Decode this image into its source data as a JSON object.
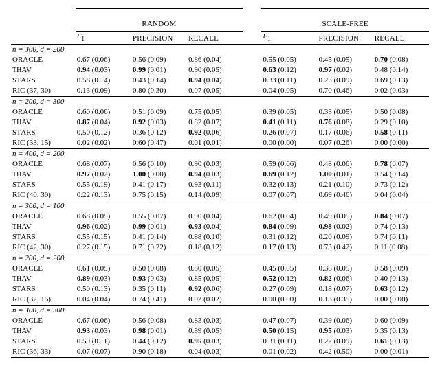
{
  "headers": {
    "super_left": "RANDOM",
    "super_right": "SCALE-FREE",
    "f1": "F",
    "f1_sub": "1",
    "precision": "PRECISION",
    "recall": "RECALL"
  },
  "row_labels": {
    "oracle": "ORACLE",
    "thav": "THAV",
    "stars": "STARS",
    "ric": "RIC"
  },
  "chart_data": {
    "type": "table",
    "columns": [
      "RANDOM F1",
      "RANDOM Precision",
      "RANDOM Recall",
      "SCALE-FREE F1",
      "SCALE-FREE Precision",
      "SCALE-FREE Recall"
    ],
    "blocks": [
      {
        "title": "n = 300, d = 200",
        "ric_suffix": " (37, 30)",
        "cells": [
          [
            "0.67 (0.06)",
            "0.56 (0.09)",
            "0.86 (0.04)",
            "0.55 (0.05)",
            "0.45 (0.05)",
            "0.70 (0.08)"
          ],
          [
            "0.94 (0.03)",
            "0.99 (0.01)",
            "0.90 (0.05)",
            "0.63 (0.12)",
            "0.97 (0.02)",
            "0.48 (0.14)"
          ],
          [
            "0.58 (0.14)",
            "0.43 (0.14)",
            "0.94 (0.04)",
            "0.33 (0.11)",
            "0.23 (0.09)",
            "0.69 (0.13)"
          ],
          [
            "0.13 (0.09)",
            "0.80 (0.30)",
            "0.07 (0.05)",
            "0.04 (0.05)",
            "0.70 (0.46)",
            "0.02 (0.03)"
          ]
        ],
        "bold": [
          [
            0,
            0,
            0,
            0,
            0,
            1
          ],
          [
            1,
            1,
            0,
            1,
            1,
            0
          ],
          [
            0,
            0,
            1,
            0,
            0,
            0
          ],
          [
            0,
            0,
            0,
            0,
            0,
            0
          ]
        ]
      },
      {
        "title": "n = 200, d = 300",
        "ric_suffix": " (33, 15)",
        "cells": [
          [
            "0.60 (0.06)",
            "0.51 (0.09)",
            "0.75 (0.05)",
            "0.39 (0.05)",
            "0.33 (0.05)",
            "0.50 (0.08)"
          ],
          [
            "0.87 (0.04)",
            "0.92 (0.03)",
            "0.82 (0.07)",
            "0.41 (0.11)",
            "0.76 (0.08)",
            "0.29 (0.10)"
          ],
          [
            "0.50 (0.12)",
            "0.36 (0.12)",
            "0.92 (0.06)",
            "0.26 (0.07)",
            "0.17 (0.06)",
            "0.58 (0.11)"
          ],
          [
            "0.02 (0.02)",
            "0.60 (0.47)",
            "0.01 (0.01)",
            "0.00 (0.00)",
            "0.07 (0.26)",
            "0.00 (0.00)"
          ]
        ],
        "bold": [
          [
            0,
            0,
            0,
            0,
            0,
            0
          ],
          [
            1,
            1,
            0,
            1,
            1,
            0
          ],
          [
            0,
            0,
            1,
            0,
            0,
            1
          ],
          [
            0,
            0,
            0,
            0,
            0,
            0
          ]
        ]
      },
      {
        "title": "n = 400, d = 200",
        "ric_suffix": " (40, 30)",
        "cells": [
          [
            "0.68 (0.07)",
            "0.56 (0.10)",
            "0.90 (0.03)",
            "0.59 (0.06)",
            "0.48 (0.06)",
            "0.78 (0.07)"
          ],
          [
            "0.97 (0.02)",
            "1.00 (0.00)",
            "0.94 (0.03)",
            "0.69 (0.12)",
            "1.00 (0.01)",
            "0.54 (0.14)"
          ],
          [
            "0.55 (0.19)",
            "0.41 (0.17)",
            "0.93 (0.11)",
            "0.32 (0.13)",
            "0.21 (0.10)",
            "0.73 (0.12)"
          ],
          [
            "0.22 (0.13)",
            "0.75 (0.15)",
            "0.14 (0.09)",
            "0.07 (0.07)",
            "0.69 (0.46)",
            "0.04 (0.04)"
          ]
        ],
        "bold": [
          [
            0,
            0,
            0,
            0,
            0,
            1
          ],
          [
            1,
            1,
            1,
            1,
            1,
            0
          ],
          [
            0,
            0,
            0,
            0,
            0,
            0
          ],
          [
            0,
            0,
            0,
            0,
            0,
            0
          ]
        ]
      },
      {
        "title": "n = 300, d = 100",
        "ric_suffix": " (42, 30)",
        "cells": [
          [
            "0.68 (0.05)",
            "0.55 (0.07)",
            "0.90 (0.04)",
            "0.62 (0.04)",
            "0.49 (0.05)",
            "0.84 (0.07)"
          ],
          [
            "0.96 (0.02)",
            "0.99 (0.01)",
            "0.93 (0.04)",
            "0.84 (0.09)",
            "0.98 (0.02)",
            "0.74 (0.13)"
          ],
          [
            "0.55 (0.15)",
            "0.41 (0.14)",
            "0.88 (0.10)",
            "0.31 (0.12)",
            "0.20 (0.09)",
            "0.74 (0.11)"
          ],
          [
            "0.27 (0.15)",
            "0.71 (0.22)",
            "0.18 (0.12)",
            "0.17 (0.13)",
            "0.73 (0.42)",
            "0.11 (0.08)"
          ]
        ],
        "bold": [
          [
            0,
            0,
            0,
            0,
            0,
            1
          ],
          [
            1,
            1,
            1,
            1,
            1,
            0
          ],
          [
            0,
            0,
            0,
            0,
            0,
            0
          ],
          [
            0,
            0,
            0,
            0,
            0,
            0
          ]
        ]
      },
      {
        "title": "n = 200, d = 200",
        "ric_suffix": " (32, 15)",
        "cells": [
          [
            "0.61 (0.05)",
            "0.50 (0.08)",
            "0.80 (0.05)",
            "0.45 (0.05)",
            "0.38 (0.05)",
            "0.58 (0.09)"
          ],
          [
            "0.89 (0.03)",
            "0.93 (0.03)",
            "0.85 (0.05)",
            "0.52 (0.12)",
            "0.82 (0.06)",
            "0.40 (0.13)"
          ],
          [
            "0.50 (0.13)",
            "0.35 (0.11)",
            "0.92 (0.06)",
            "0.27 (0.09)",
            "0.18 (0.07)",
            "0.63 (0.12)"
          ],
          [
            "0.04 (0.04)",
            "0.74 (0.41)",
            "0.02 (0.02)",
            "0.00 (0.00)",
            "0.13 (0.35)",
            "0.00 (0.00)"
          ]
        ],
        "bold": [
          [
            0,
            0,
            0,
            0,
            0,
            0
          ],
          [
            1,
            1,
            0,
            1,
            1,
            0
          ],
          [
            0,
            0,
            1,
            0,
            0,
            1
          ],
          [
            0,
            0,
            0,
            0,
            0,
            0
          ]
        ]
      },
      {
        "title": "n = 300, d = 300",
        "ric_suffix": " (36, 33)",
        "cells": [
          [
            "0.67 (0.06)",
            "0.56 (0.08)",
            "0.83 (0.03)",
            "0.47 (0.07)",
            "0.39 (0.06)",
            "0.60 (0.09)"
          ],
          [
            "0.93 (0.03)",
            "0.98 (0.01)",
            "0.89 (0.05)",
            "0.50 (0.15)",
            "0.95 (0.03)",
            "0.35 (0.13)"
          ],
          [
            "0.59 (0.11)",
            "0.44 (0.12)",
            "0.95 (0.03)",
            "0.31 (0.11)",
            "0.22 (0.09)",
            "0.61 (0.13)"
          ],
          [
            "0.07 (0.07)",
            "0.90 (0.18)",
            "0.04 (0.03)",
            "0.01 (0.02)",
            "0.42 (0.50)",
            "0.00 (0.01)"
          ]
        ],
        "bold": [
          [
            0,
            0,
            0,
            0,
            0,
            0
          ],
          [
            1,
            1,
            0,
            1,
            1,
            0
          ],
          [
            0,
            0,
            1,
            0,
            0,
            1
          ],
          [
            0,
            0,
            0,
            0,
            0,
            0
          ]
        ]
      }
    ]
  }
}
